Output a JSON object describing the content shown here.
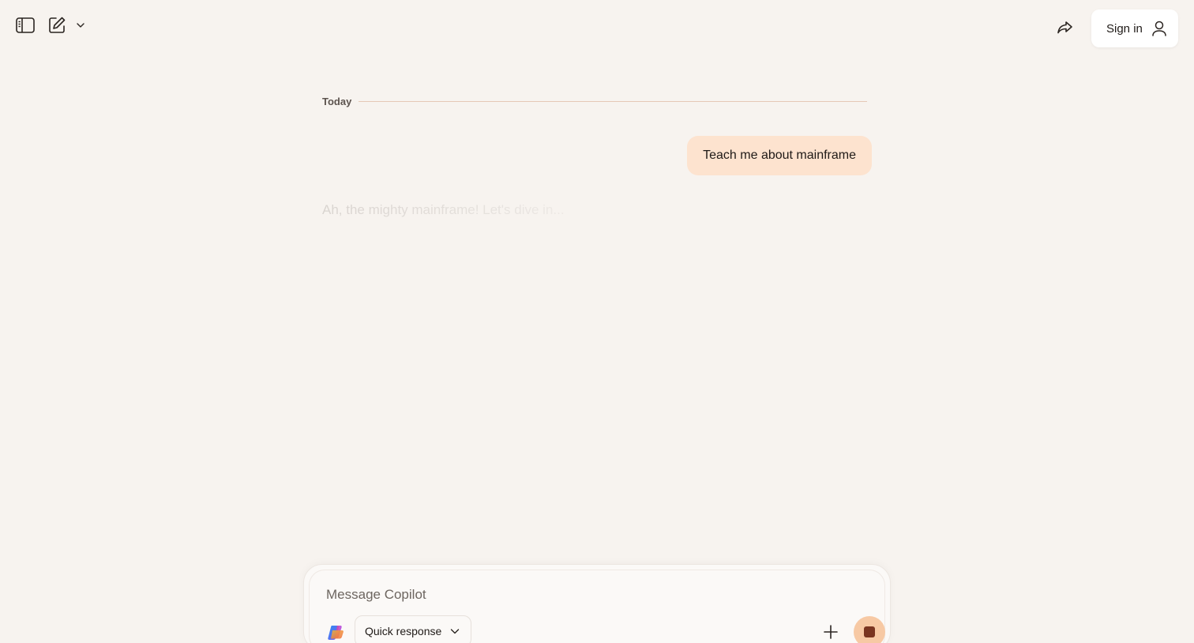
{
  "header": {
    "sidebar_icon": "sidebar-toggle-icon",
    "new_chat_icon": "compose-icon",
    "share_icon": "share-icon",
    "signin_label": "Sign in",
    "user_icon": "user-icon"
  },
  "chat": {
    "divider_label": "Today",
    "messages": [
      {
        "role": "user",
        "text": "Teach me about mainframe"
      },
      {
        "role": "assistant",
        "text": "Ah, the mighty mainframe! Let's dive in..."
      }
    ]
  },
  "composer": {
    "placeholder": "Message Copilot",
    "mode_label": "Quick response",
    "add_icon": "plus-icon",
    "stop_icon": "stop-icon"
  },
  "colors": {
    "background": "#f7f3ef",
    "user_bubble": "#fde3cf",
    "stop_button": "#f7c9a4",
    "divider": "#e6c8b6"
  }
}
